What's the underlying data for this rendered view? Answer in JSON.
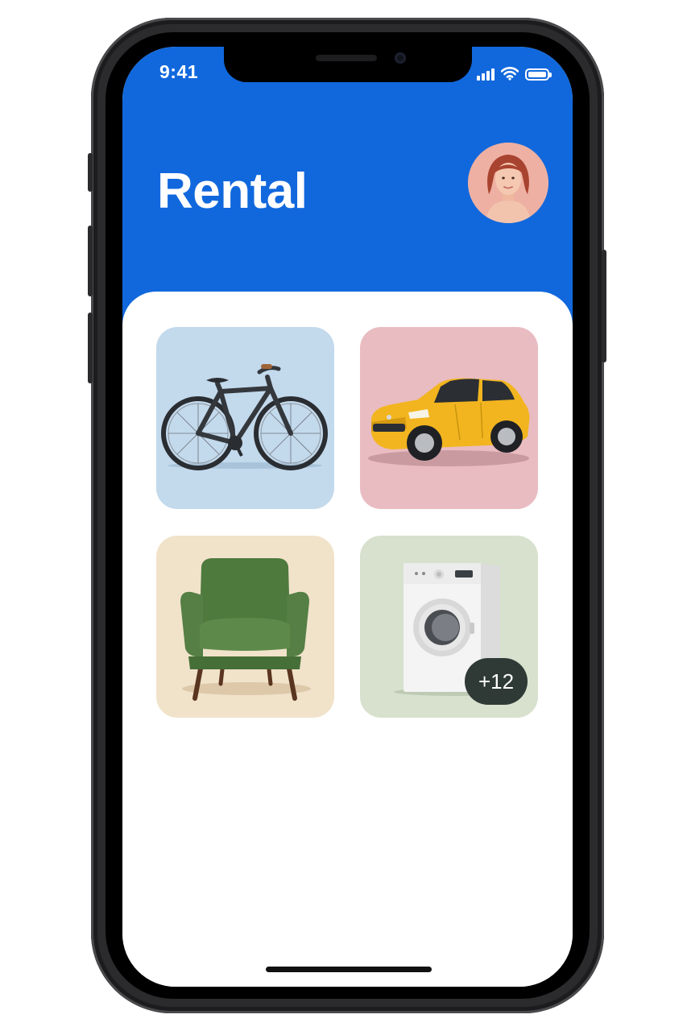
{
  "status_bar": {
    "time": "9:41",
    "icons": [
      "cellular-signal-icon",
      "wifi-icon",
      "battery-icon"
    ]
  },
  "header": {
    "title": "Rental",
    "avatar_icon": "user-avatar",
    "background_color": "#1168dd"
  },
  "categories": [
    {
      "name": "bicycle",
      "icon": "bicycle-icon",
      "tile_color": "#c3d9ec"
    },
    {
      "name": "car",
      "icon": "car-icon",
      "tile_color": "#e9bcc1"
    },
    {
      "name": "armchair",
      "icon": "armchair-icon",
      "tile_color": "#f1e2ca"
    },
    {
      "name": "washing-machine",
      "icon": "washing-machine-icon",
      "tile_color": "#d7e1cd",
      "badge": "+12"
    }
  ]
}
